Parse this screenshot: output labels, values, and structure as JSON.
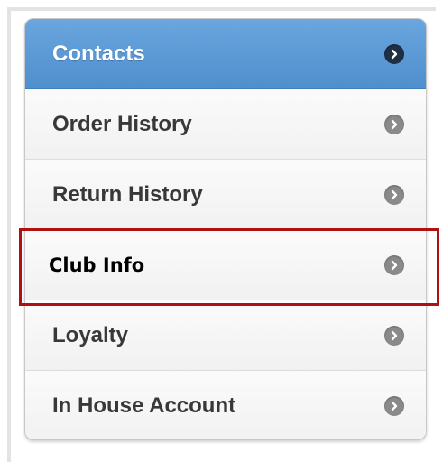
{
  "menu": {
    "items": [
      {
        "label": "Contacts",
        "icon": "chevron-right-icon",
        "active": true
      },
      {
        "label": "Order History",
        "icon": "chevron-right-icon"
      },
      {
        "label": "Return History",
        "icon": "chevron-right-icon"
      },
      {
        "label": "Club Info",
        "icon": "chevron-right-icon",
        "highlighted": true
      },
      {
        "label": "Loyalty",
        "icon": "chevron-right-icon"
      },
      {
        "label": "In House Account",
        "icon": "chevron-right-icon"
      }
    ]
  },
  "colors": {
    "active_background": "#5b9ad6",
    "active_text": "#ffffff",
    "item_text": "#383838",
    "chevron_gray": "#8a8a8a",
    "chevron_active": "#1f2f44",
    "highlight_border": "#b01010"
  }
}
